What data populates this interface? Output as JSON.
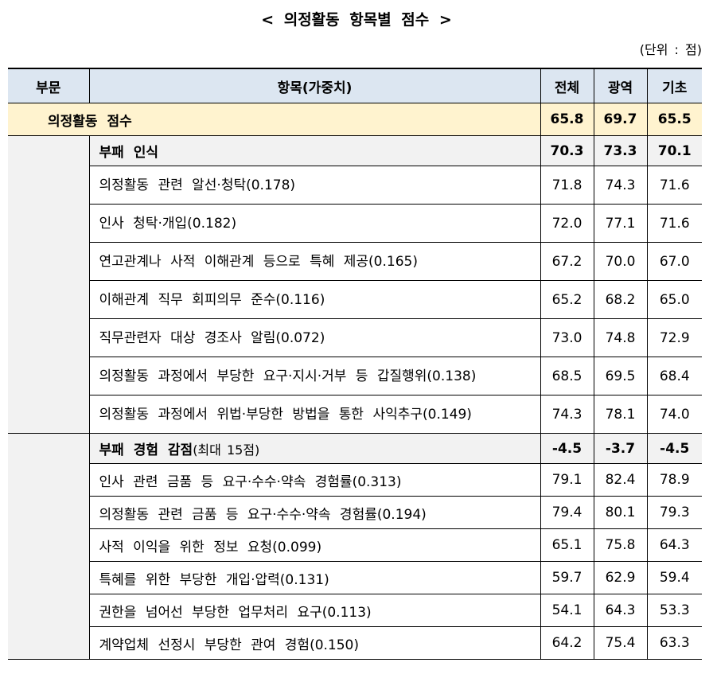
{
  "title": "< 의정활동 항목별 점수 >",
  "unit": "(단위 : 점)",
  "headers": {
    "col1": "부문",
    "col2": "항목(가중치)",
    "col3": "전체",
    "col4": "광역",
    "col5": "기초"
  },
  "score": {
    "label": "의정활동 점수",
    "all": "65.8",
    "regional": "69.7",
    "basic": "65.5"
  },
  "sections": [
    {
      "label": "부패 인식",
      "note": "",
      "all": "70.3",
      "regional": "73.3",
      "basic": "70.1",
      "items": [
        {
          "label": "의정활동 관련 알선·청탁(0.178)",
          "all": "71.8",
          "regional": "74.3",
          "basic": "71.6"
        },
        {
          "label": "인사 청탁·개입(0.182)",
          "all": "72.0",
          "regional": "77.1",
          "basic": "71.6"
        },
        {
          "label": "연고관계나 사적 이해관계 등으로 특혜 제공(0.165)",
          "all": "67.2",
          "regional": "70.0",
          "basic": "67.0"
        },
        {
          "label": "이해관계 직무 회피의무 준수(0.116)",
          "all": "65.2",
          "regional": "68.2",
          "basic": "65.0"
        },
        {
          "label": "직무관련자 대상 경조사 알림(0.072)",
          "all": "73.0",
          "regional": "74.8",
          "basic": "72.9"
        },
        {
          "label": "의정활동 과정에서 부당한 요구·지시·거부 등 갑질행위(0.138)",
          "all": "68.5",
          "regional": "69.5",
          "basic": "68.4"
        },
        {
          "label": "의정활동 과정에서 위법·부당한 방법을 통한 사익추구(0.149)",
          "all": "74.3",
          "regional": "78.1",
          "basic": "74.0"
        }
      ]
    },
    {
      "label": "부패 경험 감점",
      "note": "(최대 15점)",
      "all": "-4.5",
      "regional": "-3.7",
      "basic": "-4.5",
      "items": [
        {
          "label": "인사 관련 금품 등 요구·수수·약속 경험률(0.313)",
          "all": "79.1",
          "regional": "82.4",
          "basic": "78.9"
        },
        {
          "label": "의정활동 관련 금품 등 요구·수수·약속 경험률(0.194)",
          "all": "79.4",
          "regional": "80.1",
          "basic": "79.3"
        },
        {
          "label": "사적 이익을 위한 정보 요청(0.099)",
          "all": "65.1",
          "regional": "75.8",
          "basic": "64.3"
        },
        {
          "label": "특혜를 위한 부당한 개입·압력(0.131)",
          "all": "59.7",
          "regional": "62.9",
          "basic": "59.4"
        },
        {
          "label": "권한을 넘어선 부당한 업무처리 요구(0.113)",
          "all": "54.1",
          "regional": "64.3",
          "basic": "53.3"
        },
        {
          "label": "계약업체 선정시 부당한 관여 경험(0.150)",
          "all": "64.2",
          "regional": "75.4",
          "basic": "63.3"
        }
      ]
    }
  ]
}
